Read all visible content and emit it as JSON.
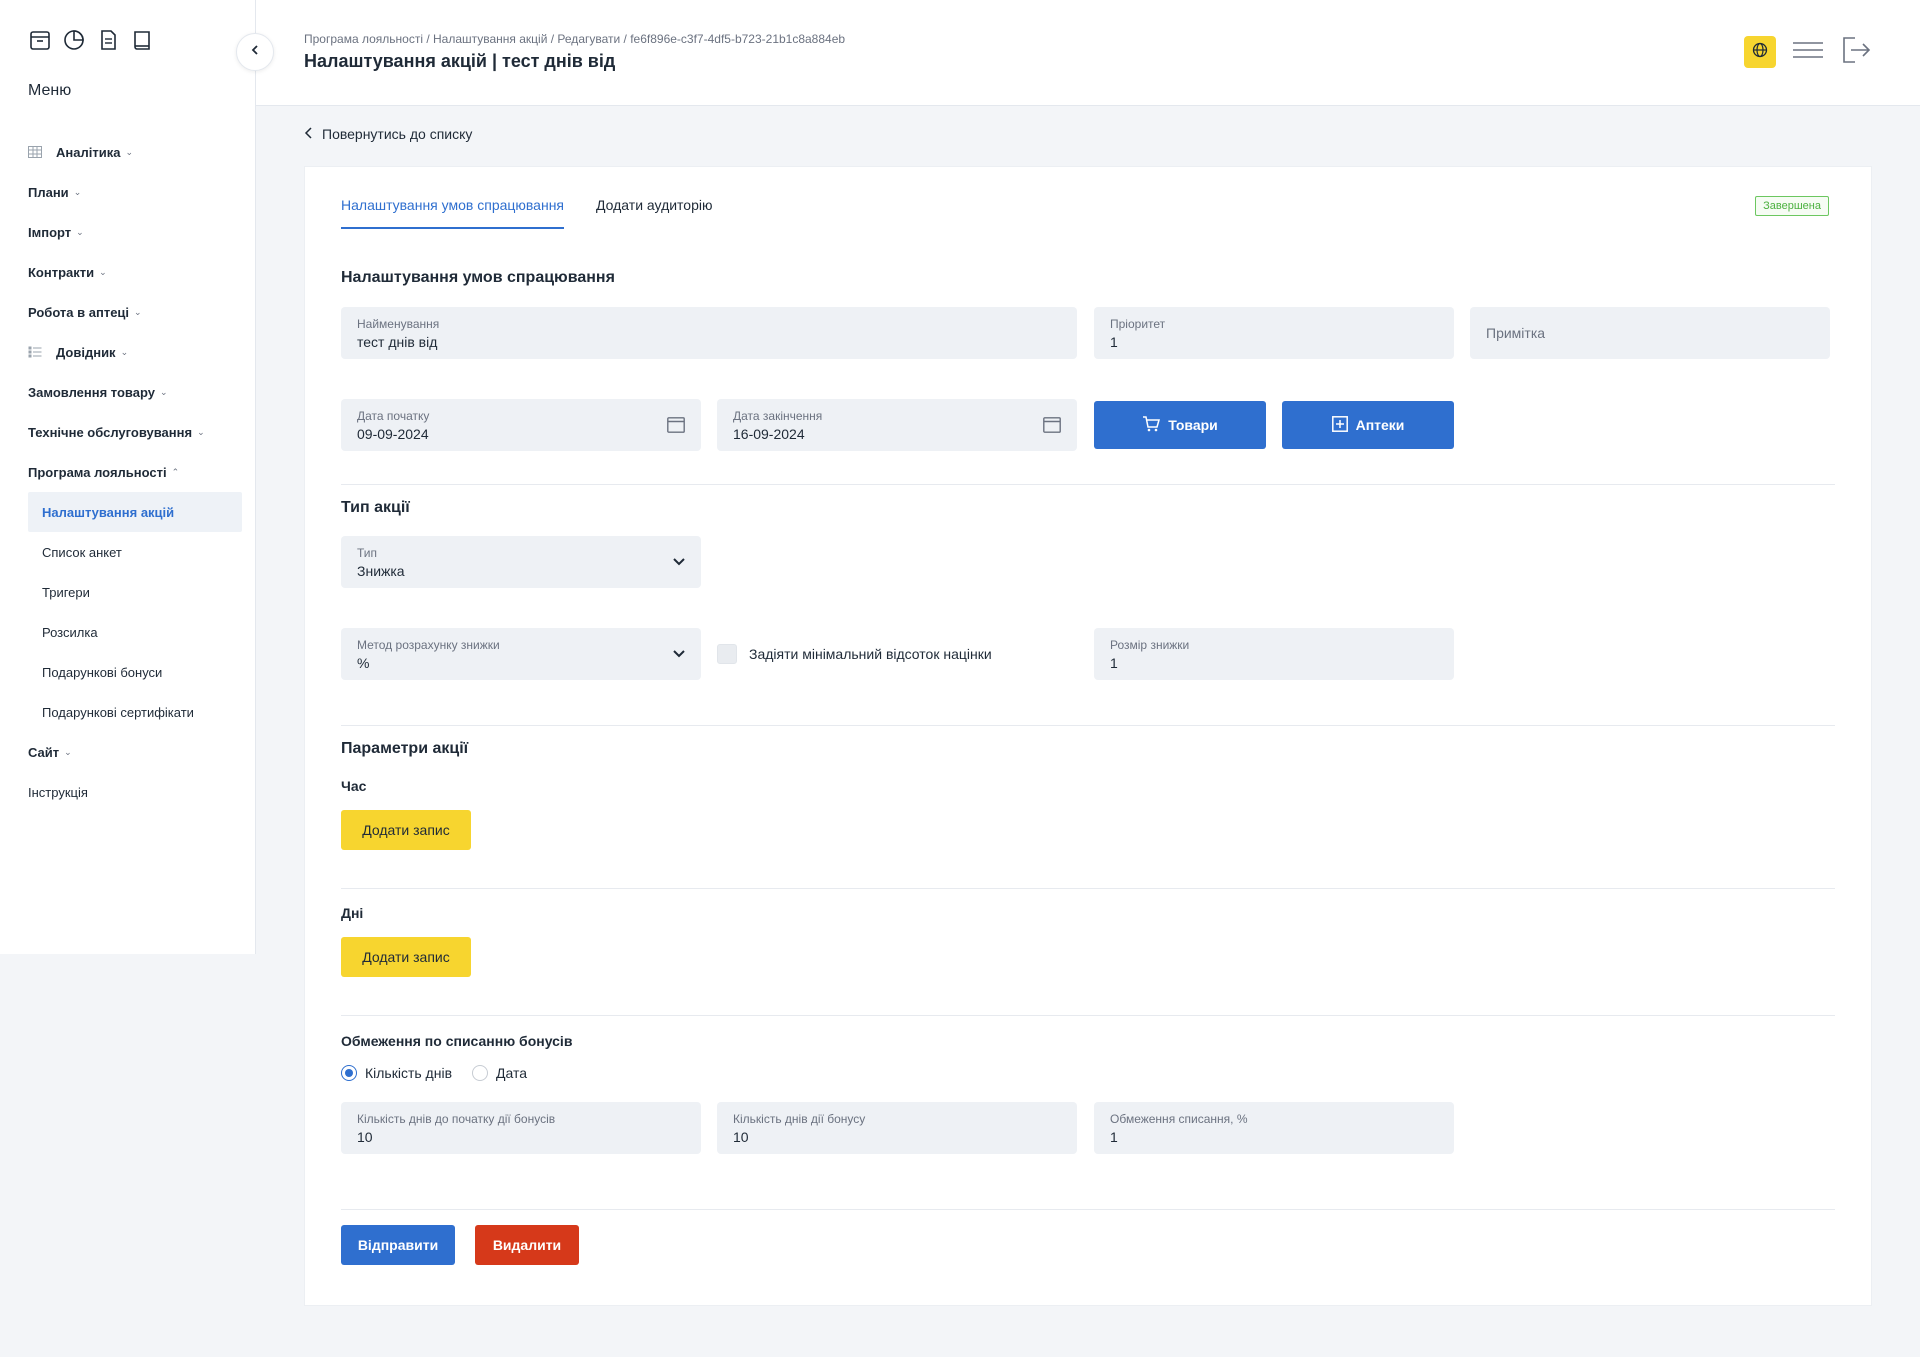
{
  "sidebar": {
    "menu_title": "Меню",
    "icons": [
      "archive-icon",
      "pie-chart-icon",
      "document-icon",
      "book-icon"
    ],
    "items": [
      {
        "label": "Аналітика",
        "icon": "table-icon"
      },
      {
        "label": "Плани"
      },
      {
        "label": "Імпорт"
      },
      {
        "label": "Контракти"
      },
      {
        "label": "Робота в аптеці"
      },
      {
        "label": "Довідник",
        "icon": "list-icon"
      },
      {
        "label": "Замовлення товару"
      },
      {
        "label": "Технічне обслуговування"
      },
      {
        "label": "Програма лояльності"
      }
    ],
    "loyalty_sub": [
      {
        "label": "Налаштування акцій",
        "active": true
      },
      {
        "label": "Список анкет"
      },
      {
        "label": "Тригери"
      },
      {
        "label": "Розсилка"
      },
      {
        "label": "Подарункові бонуси"
      },
      {
        "label": "Подарункові сертифікати"
      }
    ],
    "site_label": "Сайт",
    "instruction_label": "Інструкція"
  },
  "header": {
    "breadcrumb": "Програма лояльності / Налаштування акцій / Редагувати / fe6f896e-c3f7-4df5-b723-21b1c8a884eb",
    "title": "Налаштування акцій | тест днів від",
    "accent_color": "#f7d52f"
  },
  "back_link": "Повернутись до списку",
  "tabs": [
    {
      "label": "Налаштування умов спрацювання",
      "active": true
    },
    {
      "label": "Додати аудиторію"
    }
  ],
  "status_badge": "Завершена",
  "conditions": {
    "section_title": "Налаштування умов спрацювання",
    "name": {
      "label": "Найменування",
      "value": "тест днів від"
    },
    "priority": {
      "label": "Пріоритет",
      "value": "1"
    },
    "note": {
      "placeholder": "Примітка"
    },
    "start_date": {
      "label": "Дата початку",
      "value": "09-09-2024"
    },
    "end_date": {
      "label": "Дата закінчення",
      "value": "16-09-2024"
    },
    "goods_button": "Товари",
    "pharmacies_button": "Аптеки"
  },
  "promo_type": {
    "section_title": "Тип акції",
    "type": {
      "label": "Тип",
      "value": "Знижка"
    },
    "method": {
      "label": "Метод розрахунку знижки",
      "value": "%"
    },
    "min_markup_checkbox": {
      "label": "Задіяти мінімальний відсоток націнки",
      "checked": false
    },
    "discount_size": {
      "label": "Розмір знижки",
      "value": "1"
    }
  },
  "params": {
    "section_title": "Параметри акції",
    "time_title": "Час",
    "days_title": "Дні",
    "add_record": "Додати запис"
  },
  "bonus_limits": {
    "title": "Обмеження по списанню бонусів",
    "radio_days": "Кількість днів",
    "radio_date": "Дата",
    "selected": "days",
    "days_before": {
      "label": "Кількість днів до початку дії бонусів",
      "value": "10"
    },
    "days_active": {
      "label": "Кількість днів дії бонусу",
      "value": "10"
    },
    "limit_pct": {
      "label": "Обмеження списання, %",
      "value": "1"
    }
  },
  "actions": {
    "submit": "Відправити",
    "delete": "Видалити"
  },
  "colors": {
    "primary": "#2f6fcf",
    "accent": "#f7d52f",
    "danger": "#d6391a",
    "success": "#4cb140"
  }
}
